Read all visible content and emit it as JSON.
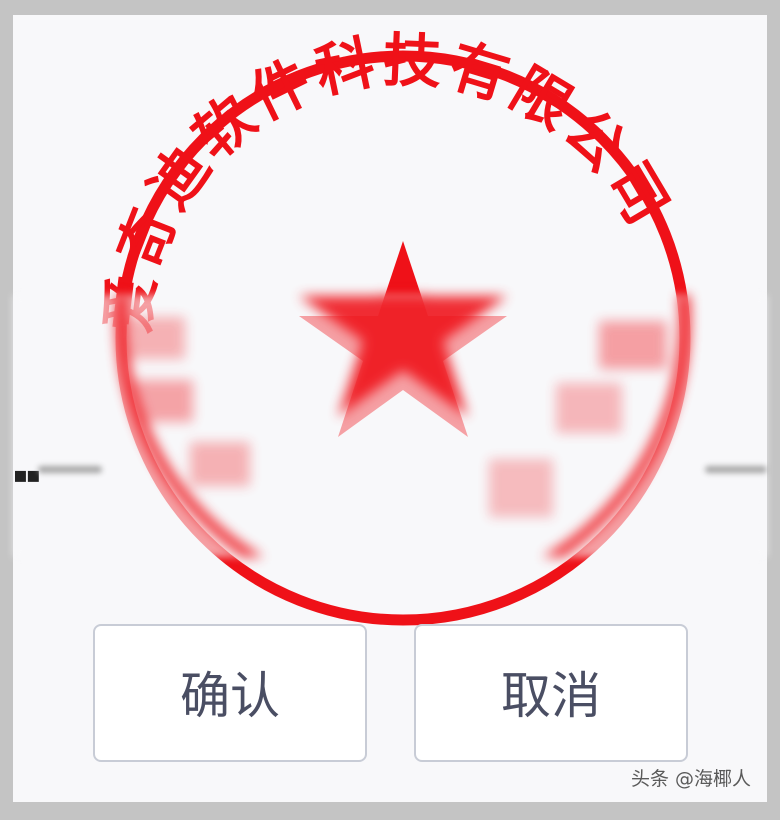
{
  "dialog": {
    "seal": {
      "text": "爱奇迪软件科技有限公司",
      "color": "#ef1118",
      "border": "#ef1118"
    },
    "buttons": {
      "confirm": "确认",
      "cancel": "取消"
    }
  },
  "watermark": {
    "text": "头条 @海椰人"
  },
  "colors": {
    "page_bg": "#c4c4c4",
    "dialog_bg": "#f8f8fa",
    "button_text": "#4a4e63",
    "button_border": "#c8ccd6"
  },
  "icons": {
    "seal_star": "star-icon",
    "more_indicator": "ellipsis-icon"
  }
}
